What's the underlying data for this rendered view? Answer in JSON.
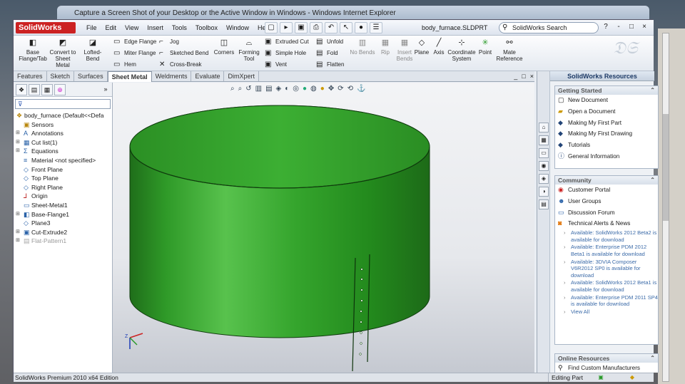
{
  "ie_window": {
    "title": "Capture a Screen Shot of your Desktop or the Active Window in Windows - Windows Internet Explorer"
  },
  "app": {
    "logo": "SolidWorks",
    "menus": [
      "File",
      "Edit",
      "View",
      "Insert",
      "Tools",
      "Toolbox",
      "Window",
      "Help"
    ],
    "document_title": "body_furnace.SLDPRT",
    "search_placeholder": "SolidWorks Search",
    "window_buttons": [
      "?",
      "-",
      "□",
      "×"
    ]
  },
  "command_manager": {
    "large_buttons": [
      {
        "label": "Base Flange/Tab",
        "icon": "base-flange-icon"
      },
      {
        "label": "Convert to Sheet Metal",
        "icon": "convert-sheet-metal-icon"
      },
      {
        "label": "Lofted-Bend",
        "icon": "lofted-bend-icon"
      }
    ],
    "col1": [
      "Edge Flange",
      "Miter Flange",
      "Hem"
    ],
    "col2": [
      "Jog",
      "Sketched Bend",
      "Cross-Break"
    ],
    "corners_label": "Corners",
    "forming_tool_label": "Forming Tool",
    "col3": [
      "Extruded Cut",
      "Simple Hole",
      "Vent"
    ],
    "col4": [
      "Unfold",
      "Fold",
      "Flatten"
    ],
    "no_bends_label": "No Bends",
    "rip_label": "Rip",
    "insert_bends_label": "Insert Bends",
    "ref_buttons": [
      "Plane",
      "Axis",
      "Coordinate System",
      "Point",
      "Mate Reference"
    ]
  },
  "tabs": [
    "Features",
    "Sketch",
    "Surfaces",
    "Sheet Metal",
    "Weldments",
    "Evaluate",
    "DimXpert"
  ],
  "active_tab": "Sheet Metal",
  "feature_tree": {
    "root": "body_furnace  (Default<<Defa",
    "items": [
      {
        "label": "Sensors",
        "icon": "sensors-icon"
      },
      {
        "label": "Annotations",
        "icon": "annotations-icon"
      },
      {
        "label": "Cut list(1)",
        "icon": "cut-list-icon"
      },
      {
        "label": "Equations",
        "icon": "equations-icon"
      },
      {
        "label": "Material <not specified>",
        "icon": "material-icon"
      },
      {
        "label": "Front Plane",
        "icon": "plane-icon"
      },
      {
        "label": "Top Plane",
        "icon": "plane-icon"
      },
      {
        "label": "Right Plane",
        "icon": "plane-icon"
      },
      {
        "label": "Origin",
        "icon": "origin-icon"
      },
      {
        "label": "Sheet-Metal1",
        "icon": "sheet-metal-icon"
      },
      {
        "label": "Base-Flange1",
        "icon": "base-flange-icon"
      },
      {
        "label": "Plane3",
        "icon": "plane-icon"
      },
      {
        "label": "Cut-Extrude2",
        "icon": "cut-extrude-icon"
      },
      {
        "label": "Flat-Pattern1",
        "icon": "flat-pattern-icon"
      }
    ]
  },
  "taskpane": {
    "title": "SolidWorks Resources",
    "getting_started": {
      "heading": "Getting Started",
      "items": [
        "New Document",
        "Open a Document",
        "Making My First Part",
        "Making My First Drawing",
        "Tutorials",
        "General Information"
      ]
    },
    "community": {
      "heading": "Community",
      "items": [
        "Customer Portal",
        "User Groups",
        "Discussion Forum",
        "Technical Alerts & News"
      ],
      "news": [
        "Available: SolidWorks 2012 Beta2 is available for download",
        "Available: Enterprise PDM 2012 Beta1 is available for download",
        "Available: 3DVIA Composer V6R2012 SP0 is available for download",
        "Available: SolidWorks 2012 Beta1 is available for download",
        "Available: Enterprise PDM 2011 SP4 is available for download"
      ],
      "view_all": "View All"
    },
    "online": {
      "heading": "Online Resources",
      "items": [
        "Find Custom Manufacturers"
      ]
    }
  },
  "status": {
    "edition": "SolidWorks Premium 2010 x64 Edition",
    "mode": "Editing Part"
  },
  "colors": {
    "part_green": "#2f9a28",
    "accent": "#c22222"
  }
}
